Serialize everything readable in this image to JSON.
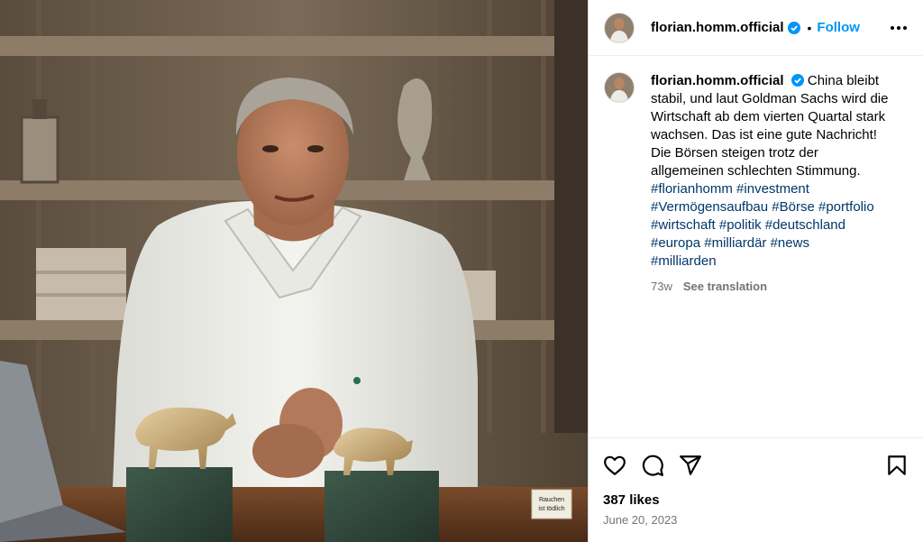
{
  "post": {
    "username": "florian.homm.official",
    "follow_label": "Follow",
    "separator": "•",
    "caption": "China bleibt stabil, und laut Goldman Sachs wird die Wirtschaft ab dem vierten Quartal stark wachsen. Das ist eine gute Nachricht! Die Börsen steigen trotz der allgemeinen schlechten Stimmung.",
    "hashtags": [
      "#florianhomm",
      "#investment",
      "#Vermögensaufbau",
      "#Börse",
      "#portfolio",
      "#wirtschaft",
      "#politik",
      "#deutschland",
      "#europa",
      "#milliardär",
      "#news",
      "#milliarden"
    ],
    "age": "73w",
    "see_translation": "See translation",
    "likes": "387 likes",
    "date": "June 20, 2023",
    "photo_sign_text": "Rauchen ist tödlich"
  },
  "icons": {
    "verified": "verified-badge-icon",
    "more": "more-options-icon",
    "like": "heart-icon",
    "comment": "comment-icon",
    "share": "share-icon",
    "save": "bookmark-icon"
  },
  "colors": {
    "link": "#0095f6",
    "hashtag": "#00376b",
    "muted": "#737373"
  }
}
